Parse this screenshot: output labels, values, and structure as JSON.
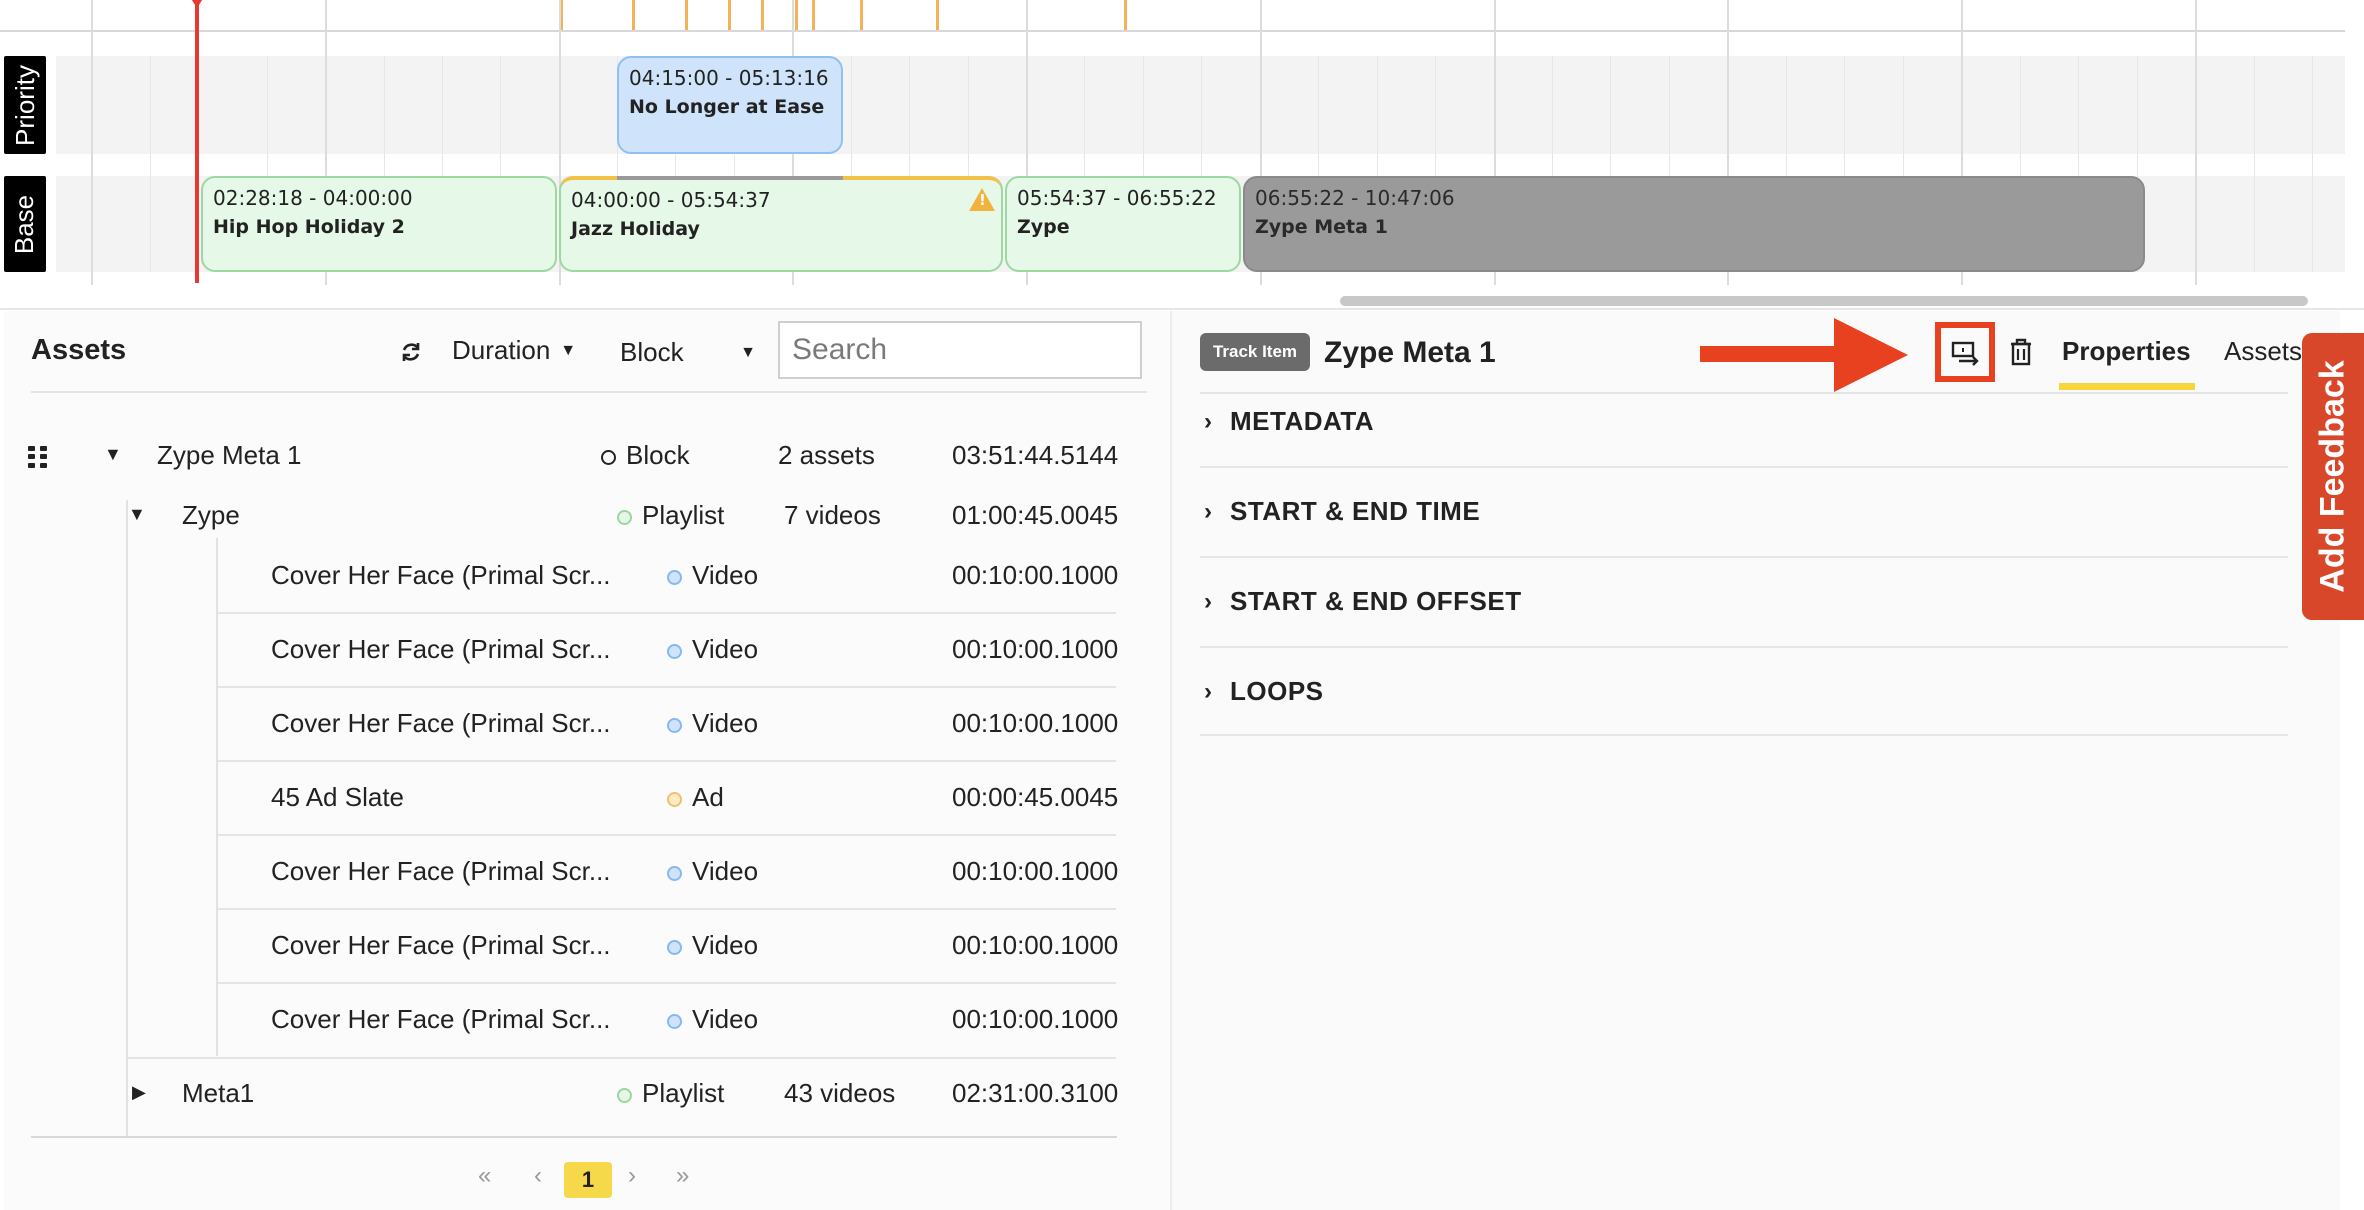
{
  "timeline": {
    "tracks": [
      {
        "label": "Priority"
      },
      {
        "label": "Base"
      }
    ],
    "priority_blocks": [
      {
        "time": "04:15:00 - 05:13:16",
        "name": "No Longer at Ease"
      }
    ],
    "base_blocks": [
      {
        "time": "02:28:18 - 04:00:00",
        "name": "Hip Hop Holiday 2"
      },
      {
        "time": "04:00:00 - 05:54:37",
        "name": "Jazz Holiday",
        "warning": true
      },
      {
        "time": "05:54:37 - 06:55:22",
        "name": "Zype"
      },
      {
        "time": "06:55:22 - 10:47:06",
        "name": "Zype Meta 1"
      }
    ]
  },
  "assets": {
    "title": "Assets",
    "refresh_icon": "refresh-icon",
    "sort_label": "Duration",
    "filter_label": "Block",
    "search_placeholder": "Search",
    "rows": [
      {
        "name": "Zype Meta 1",
        "type": "Block",
        "count": "2 assets",
        "duration": "03:51:44.5144"
      },
      {
        "name": "Zype",
        "type": "Playlist",
        "count": "7 videos",
        "duration": "01:00:45.0045"
      },
      {
        "name": "Cover Her Face (Primal Scr...",
        "type": "Video",
        "duration": "00:10:00.1000"
      },
      {
        "name": "Cover Her Face (Primal Scr...",
        "type": "Video",
        "duration": "00:10:00.1000"
      },
      {
        "name": "Cover Her Face (Primal Scr...",
        "type": "Video",
        "duration": "00:10:00.1000"
      },
      {
        "name": "45 Ad Slate",
        "type": "Ad",
        "duration": "00:00:45.0045"
      },
      {
        "name": "Cover Her Face (Primal Scr...",
        "type": "Video",
        "duration": "00:10:00.1000"
      },
      {
        "name": "Cover Her Face (Primal Scr...",
        "type": "Video",
        "duration": "00:10:00.1000"
      },
      {
        "name": "Cover Her Face (Primal Scr...",
        "type": "Video",
        "duration": "00:10:00.1000"
      },
      {
        "name": "Meta1",
        "type": "Playlist",
        "count": "43 videos",
        "duration": "02:31:00.3100"
      }
    ],
    "pagination": {
      "first": "«",
      "prev": "‹",
      "current": "1",
      "next": "›",
      "last": "»"
    }
  },
  "details": {
    "badge": "Track Item",
    "title": "Zype Meta 1",
    "tabs": [
      {
        "label": "Properties",
        "active": true
      },
      {
        "label": "Assets",
        "active": false
      }
    ],
    "sections": [
      "METADATA",
      "START & END TIME",
      "START & END OFFSET",
      "LOOPS"
    ]
  },
  "feedback": {
    "label": "Add Feedback"
  },
  "colors": {
    "accent_yellow": "#f5d63d",
    "annotation_red": "#e8411f",
    "feedback": "#d8472a"
  }
}
